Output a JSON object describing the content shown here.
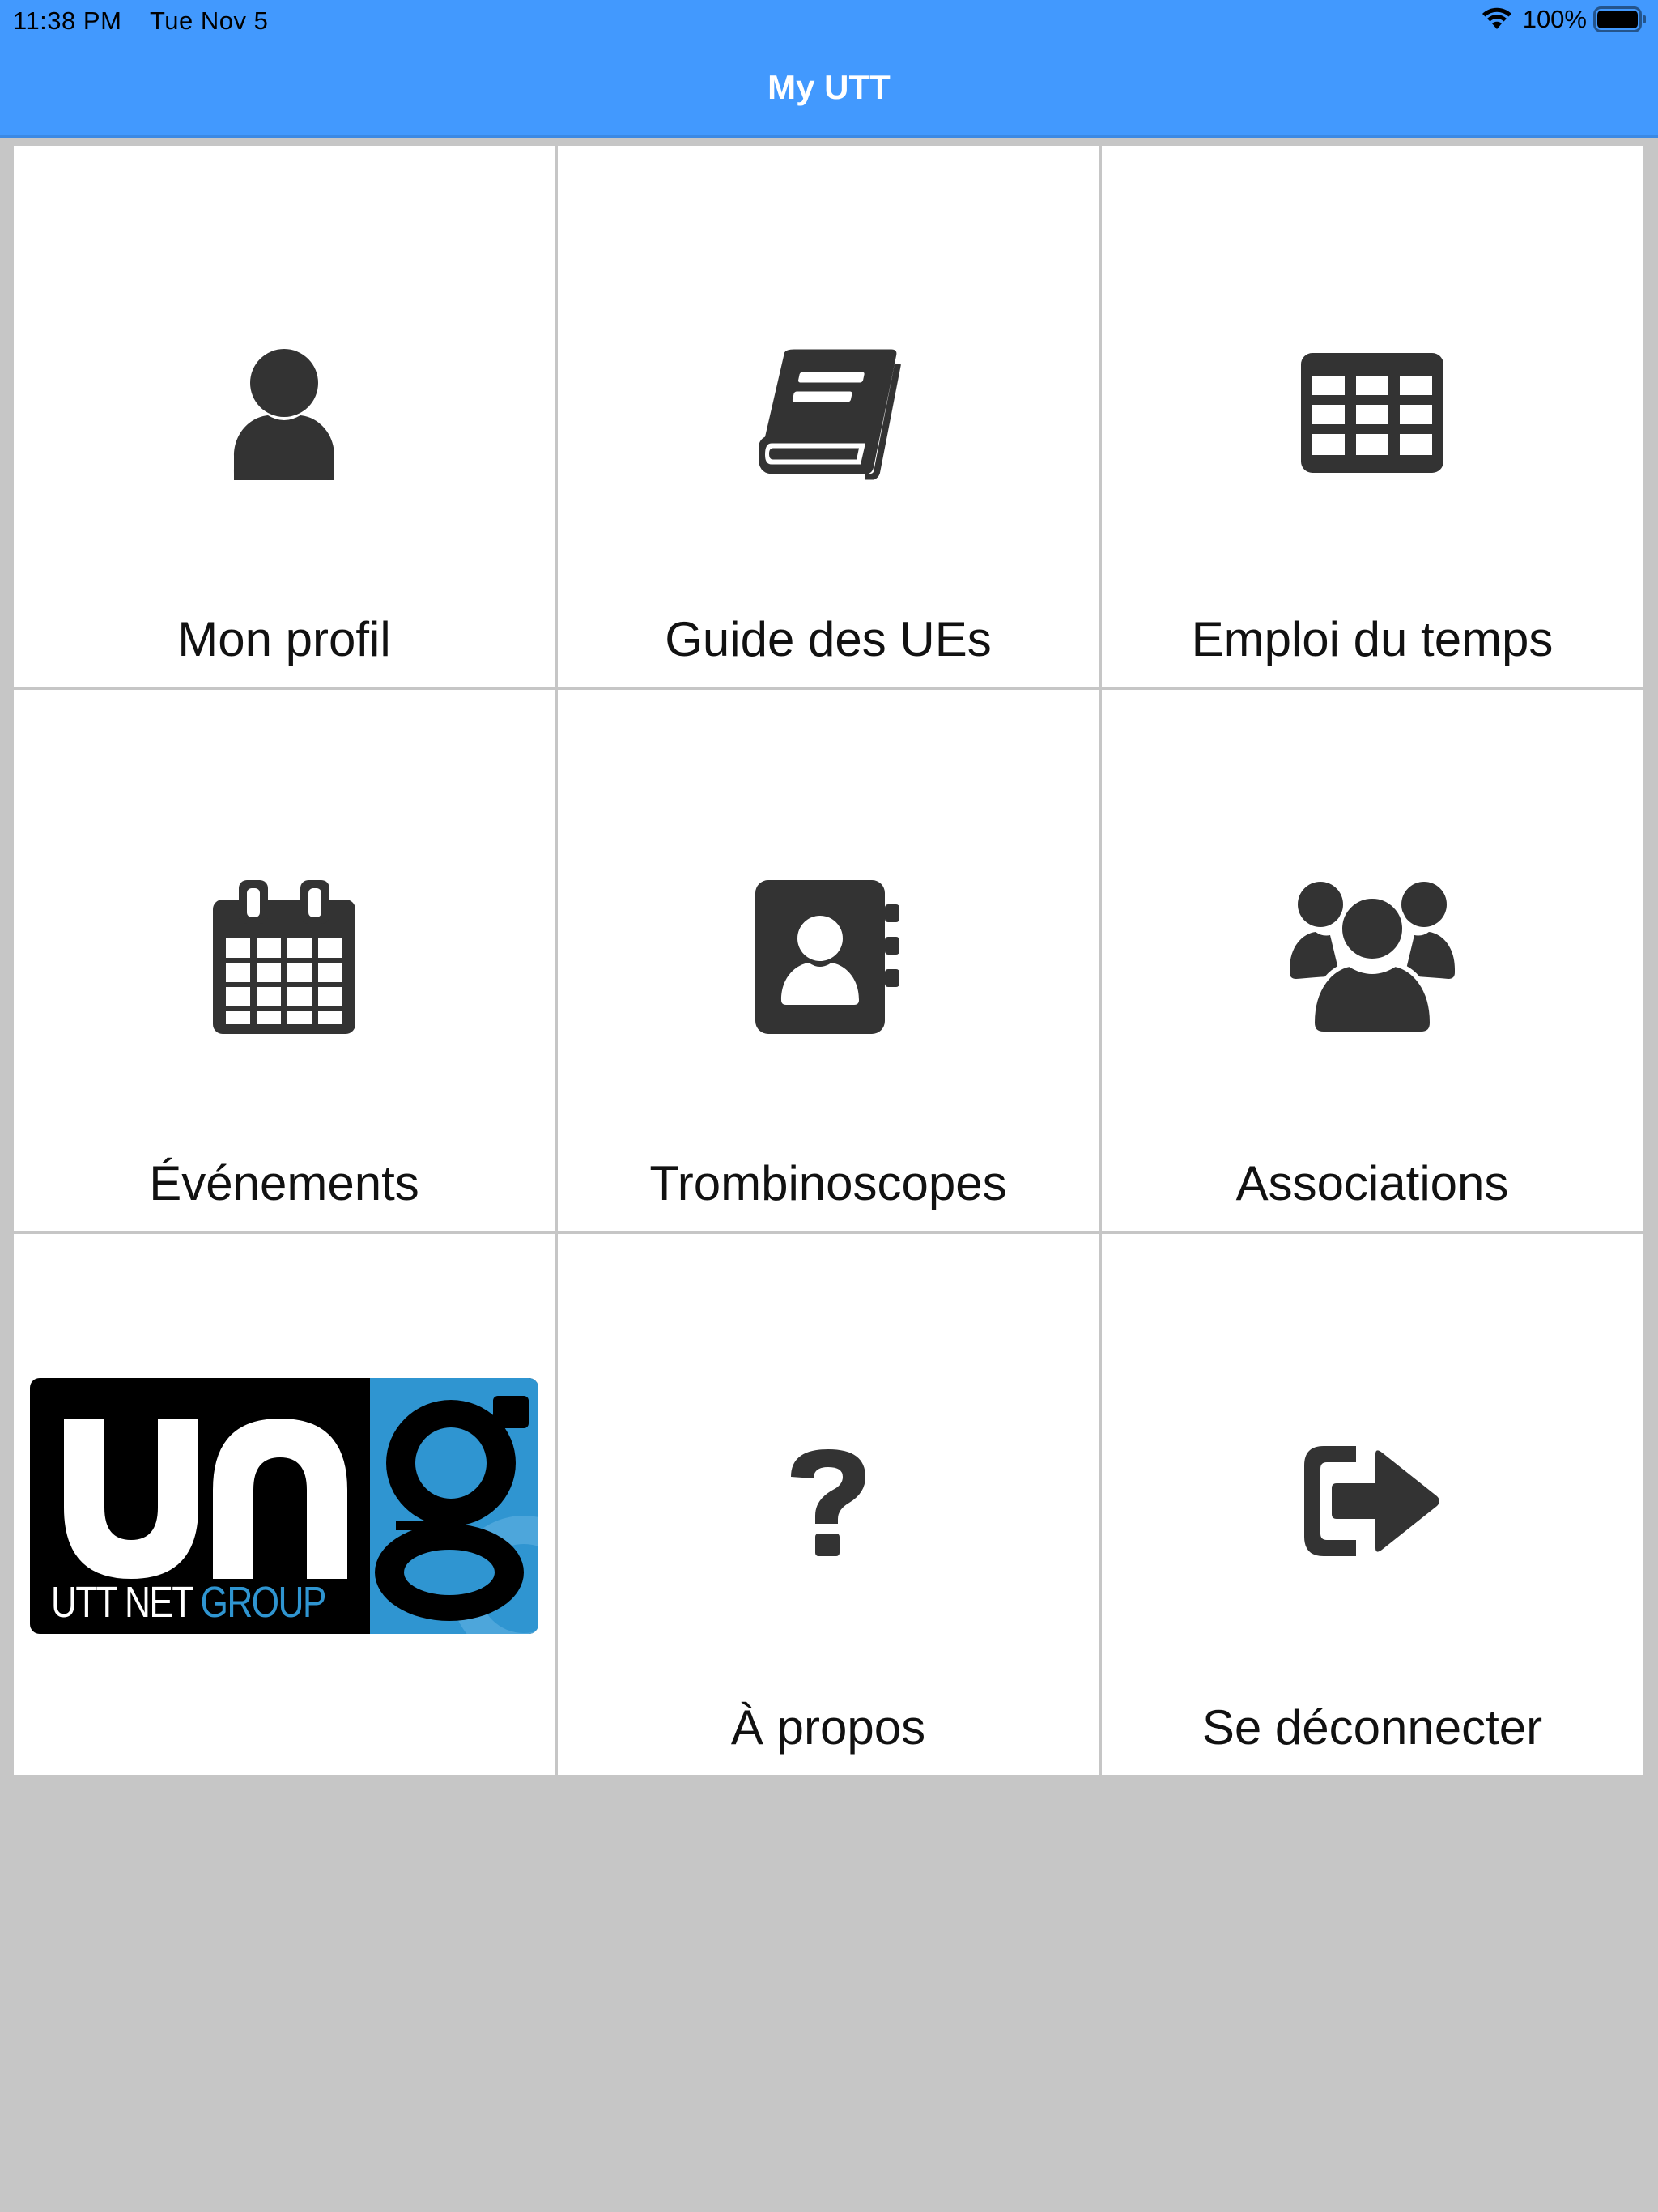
{
  "status_bar": {
    "time": "11:38 PM",
    "date": "Tue Nov 5",
    "battery": "100%"
  },
  "nav": {
    "title": "My UTT"
  },
  "tiles": [
    {
      "label": "Mon profil",
      "icon": "user-icon"
    },
    {
      "label": "Guide des UEs",
      "icon": "book-icon"
    },
    {
      "label": "Emploi du temps",
      "icon": "table-icon"
    },
    {
      "label": "Événements",
      "icon": "calendar-icon"
    },
    {
      "label": "Trombinoscopes",
      "icon": "address-book-icon"
    },
    {
      "label": "Associations",
      "icon": "users-icon"
    },
    {
      "label": "",
      "icon": "ung-logo"
    },
    {
      "label": "À propos",
      "icon": "question-icon"
    },
    {
      "label": "Se déconnecter",
      "icon": "sign-out-icon"
    }
  ],
  "logo": {
    "text_main": "un",
    "text_g": "g",
    "text_utt_net": "UTT NET",
    "text_group": "GROUP"
  },
  "colors": {
    "nav_blue": "#4299fe",
    "icon_dark": "#333333",
    "background_gray": "#c6c6c6",
    "logo_blue": "#2f95d1"
  }
}
